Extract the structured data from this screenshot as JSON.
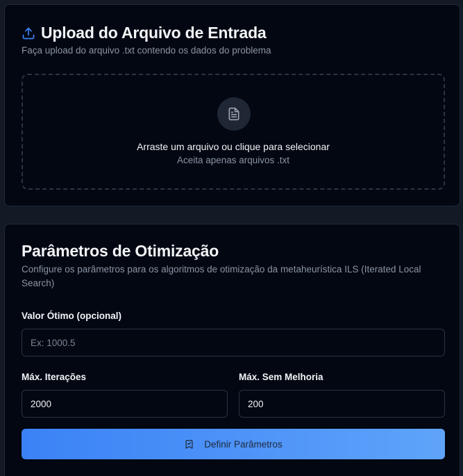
{
  "upload": {
    "title": "Upload do Arquivo de Entrada",
    "subtitle": "Faça upload do arquivo .txt contendo os dados do problema",
    "dropzone_main": "Arraste um arquivo ou clique para selecionar",
    "dropzone_sub": "Aceita apenas arquivos .txt",
    "title_icon": "upload-icon",
    "dropzone_icon": "file-text-icon"
  },
  "params": {
    "title": "Parâmetros de Otimização",
    "subtitle": "Configure os parâmetros para os algoritmos de otimização da metaheurística ILS (Iterated Local Search)",
    "optimal_label": "Valor Ótimo (opcional)",
    "optimal_placeholder": "Ex: 1000.5",
    "optimal_value": "",
    "max_iter_label": "Máx. Iterações",
    "max_iter_value": "2000",
    "max_no_improve_label": "Máx. Sem Melhoria",
    "max_no_improve_value": "200",
    "submit_label": "Definir Parâmetros",
    "submit_icon": "bookmark-check-icon"
  },
  "colors": {
    "accent": "#3b82f6",
    "background": "#020712",
    "page": "#131a26"
  }
}
